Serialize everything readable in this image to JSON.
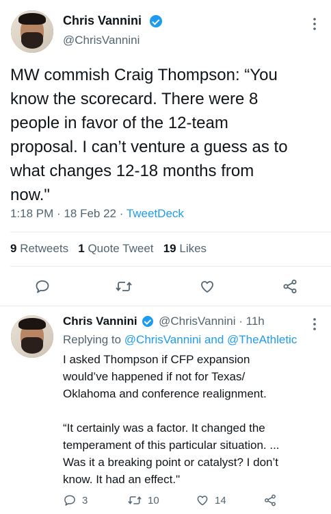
{
  "main_tweet": {
    "author_name": "Chris Vannini",
    "author_handle": "@ChrisVannini",
    "text_lines": [
      "MW commish Craig Thompson: “You",
      "know the scorecard. There were 8",
      "people in favor of the 12-team",
      "proposal. I can’t venture a guess as to",
      "what changes 12-18 months from",
      "now.\""
    ],
    "time": "1:18 PM",
    "date": "18 Feb 22",
    "source": "TweetDeck",
    "retweets_count": "9",
    "retweets_label": "Retweets",
    "quote_count": "1",
    "quote_label": "Quote Tweet",
    "likes_count": "19",
    "likes_label": "Likes"
  },
  "reply_tweet": {
    "author_name": "Chris Vannini",
    "author_handle": "@ChrisVannini",
    "time_ago": "11h",
    "replying_prefix": "Replying to",
    "replying_to_1": "@ChrisVannini",
    "replying_and": "and",
    "replying_to_2": "@TheAthletic",
    "paragraph1_lines": [
      "I asked Thompson if CFP expansion",
      "would’ve happened if not for Texas/",
      "Oklahoma and conference realignment."
    ],
    "paragraph2_lines": [
      "“It certainly was a factor. It changed the",
      "temperament of this particular situation. ...",
      "Was it a breaking point or catalyst? I don’t",
      "know. It had an effect.\""
    ],
    "reply_count": "3",
    "retweet_count": "10",
    "like_count": "14"
  },
  "colors": {
    "accent": "#1d9bf0",
    "text": "#0f1419",
    "secondary": "#536471",
    "divider": "#e6ecf0"
  }
}
